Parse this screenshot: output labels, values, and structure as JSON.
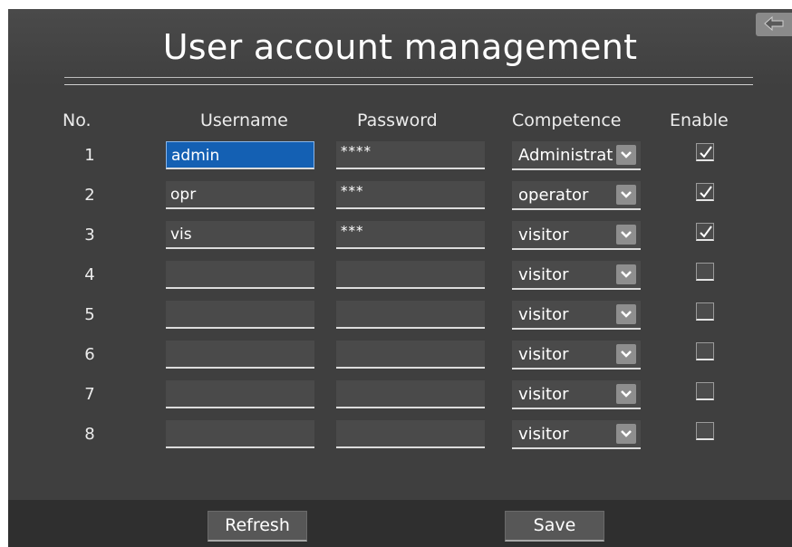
{
  "title": "User account management",
  "columns": {
    "no": "No.",
    "username": "Username",
    "password": "Password",
    "competence": "Competence",
    "enable": "Enable"
  },
  "rows": [
    {
      "no": "1",
      "username": "admin",
      "password": "****",
      "competence": "Administrator",
      "enabled": true,
      "active": true
    },
    {
      "no": "2",
      "username": "opr",
      "password": "***",
      "competence": "operator",
      "enabled": true
    },
    {
      "no": "3",
      "username": "vis",
      "password": "***",
      "competence": "visitor",
      "enabled": true
    },
    {
      "no": "4",
      "username": "",
      "password": "",
      "competence": "visitor",
      "enabled": false
    },
    {
      "no": "5",
      "username": "",
      "password": "",
      "competence": "visitor",
      "enabled": false
    },
    {
      "no": "6",
      "username": "",
      "password": "",
      "competence": "visitor",
      "enabled": false
    },
    {
      "no": "7",
      "username": "",
      "password": "",
      "competence": "visitor",
      "enabled": false
    },
    {
      "no": "8",
      "username": "",
      "password": "",
      "competence": "visitor",
      "enabled": false
    }
  ],
  "buttons": {
    "refresh": "Refresh",
    "save": "Save"
  },
  "icons": {
    "back": "back-arrow-icon",
    "dropdown": "chevron-down-icon",
    "check": "checkmark-icon"
  },
  "colors": {
    "panel": "#3f3f3f",
    "footer": "#2f2f2f",
    "active_field": "#1460b3"
  }
}
